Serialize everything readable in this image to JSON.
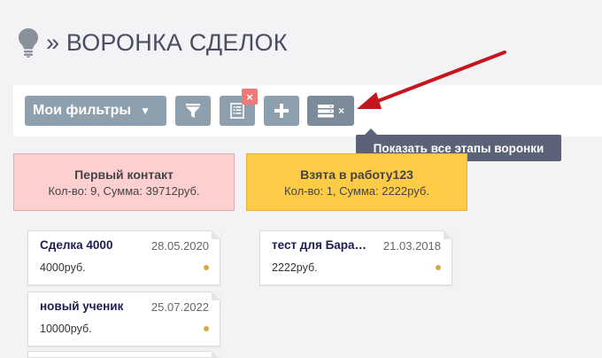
{
  "header": {
    "title": "» ВОРОНКА СДЕЛОК",
    "icon": "lightbulb-icon"
  },
  "toolbar": {
    "filters_label": "Мои фильтры",
    "caret": "▼",
    "close_badge": "×",
    "stages_x": "×"
  },
  "tooltip": {
    "text": "Показать все этапы воронки"
  },
  "stages": [
    {
      "title": "Первый контакт",
      "stats": "Кол-во: 9, Сумма: 39712руб.",
      "color": "#fecfcf"
    },
    {
      "title": "Взята в работу123",
      "stats": "Кол-во: 1, Сумма: 2222руб.",
      "color": "#fecb47"
    }
  ],
  "deals": [
    {
      "name": "Сделка 4000",
      "date": "28.05.2020",
      "sum": "4000руб."
    },
    {
      "name": "новый ученик",
      "date": "25.07.2022",
      "sum": "10000руб."
    },
    {
      "name": "тест для Бара…",
      "date": "21.03.2018",
      "sum": "2222руб."
    }
  ],
  "colors": {
    "accent_arrow": "#c4161c",
    "button": "#8e9fad",
    "tooltip": "#5b6277",
    "title": "#4a4d63"
  }
}
